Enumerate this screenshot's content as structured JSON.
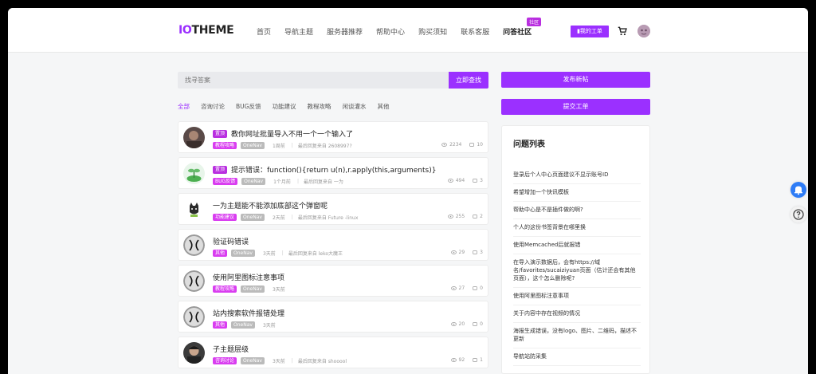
{
  "header": {
    "logo_io": "IO",
    "logo_theme": "THEME",
    "nav": [
      {
        "label": "首页",
        "active": false
      },
      {
        "label": "导航主题",
        "active": false
      },
      {
        "label": "服务器推荐",
        "active": false
      },
      {
        "label": "帮助中心",
        "active": false
      },
      {
        "label": "购买须知",
        "active": false
      },
      {
        "label": "联系客服",
        "active": false
      },
      {
        "label": "问答社区",
        "active": true,
        "badge": "社区"
      }
    ],
    "ticket_button": "我的工单",
    "cart_icon": "cart-icon",
    "avatar_icon": "user-avatar"
  },
  "search": {
    "placeholder": "找寻答案",
    "button": "立即查找"
  },
  "tabs": [
    "全部",
    "咨询讨论",
    "BUG反馈",
    "功能建议",
    "教程攻略",
    "闲谈灌水",
    "其他"
  ],
  "active_tab": "全部",
  "posts": [
    {
      "pinned": "置顶",
      "title": "教你网址批量导入不用一个一个输入了",
      "category": "教程攻略",
      "platform": "OneNav",
      "time": "1周前",
      "last_reply": "最后回复来自 2608997?",
      "views": "2234",
      "comments": "10",
      "avatar": "avatar-photo"
    },
    {
      "pinned": "置顶",
      "title": "提示错误：function(){return u(n),r.apply(this,arguments)}",
      "category": "BUG反馈",
      "platform": "OneNav",
      "time": "1个月前",
      "last_reply": "最后回复来自 一为",
      "views": "494",
      "comments": "3",
      "avatar": "avatar-sprout"
    },
    {
      "pinned": "",
      "title": "一为主题能不能添加底部这个弹窗呢",
      "category": "功能建议",
      "platform": "OneNav",
      "time": "2天前",
      "last_reply": "最后回复来自 Future -linux",
      "views": "255",
      "comments": "2",
      "avatar": "avatar-cat"
    },
    {
      "pinned": "",
      "title": "验证码错误",
      "category": "其他",
      "platform": "OneNav",
      "time": "3天前",
      "last_reply": "最后回复来自 leko大魔王",
      "views": "29",
      "comments": "3",
      "avatar": "avatar-chi"
    },
    {
      "pinned": "",
      "title": "使用阿里图标注意事项",
      "category": "教程攻略",
      "platform": "OneNav",
      "time": "3天前",
      "last_reply": "",
      "views": "27",
      "comments": "0",
      "avatar": "avatar-chi"
    },
    {
      "pinned": "",
      "title": "站内搜索软件报错处理",
      "category": "其他",
      "platform": "OneNav",
      "time": "3天前",
      "last_reply": "",
      "views": "20",
      "comments": "0",
      "avatar": "avatar-chi"
    },
    {
      "pinned": "",
      "title": "子主题层级",
      "category": "咨询讨论",
      "platform": "OneNav",
      "time": "3天前",
      "last_reply": "最后回复来自 shooool",
      "views": "92",
      "comments": "1",
      "avatar": "avatar-person"
    }
  ],
  "sidebar": {
    "post_button": "发布新帖",
    "ticket_button": "提交工单",
    "panel_title": "问题列表",
    "questions": [
      "登录后个人中心页面建议不显示账号ID",
      "希望增加一个快讯模板",
      "帮助中心是不是插件做的啊?",
      "个人的这份书签背景在哪里换",
      "使用Memcached后就报错",
      "在导入演示数据后，会有https://域名/favorites/sucaiziyuan页面（估计还会有其他页面），这个怎么删除呢?",
      "使用阿里图标注意事项",
      "关于内容中存在视频的情况",
      "海报生成错误，没有logo、图片、二维码，描述不更新",
      "导航站防采集"
    ]
  },
  "floating": [
    "bell-icon",
    "help-icon"
  ],
  "colors": {
    "accent": "#9b30ff",
    "tag_pink": "#d93df0",
    "tag_gray": "#bbbbbb"
  }
}
